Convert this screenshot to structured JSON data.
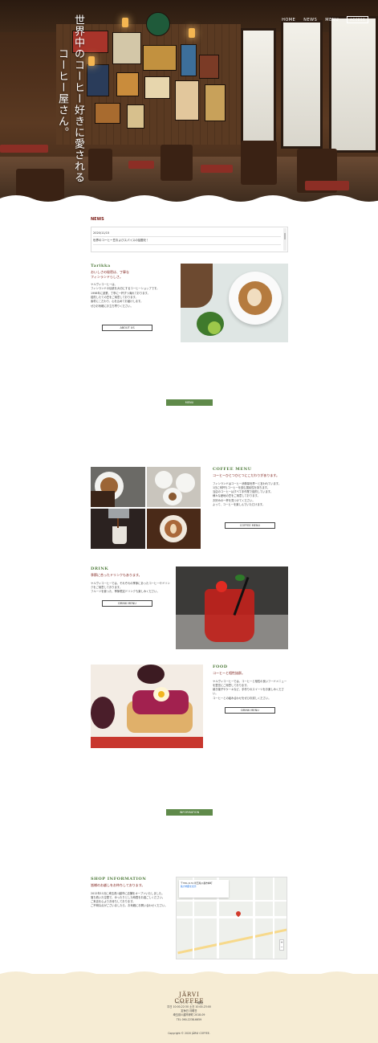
{
  "hero": {
    "title_line1": "世界中のコーヒー好きに愛される",
    "title_line2": "コーヒー屋さん。"
  },
  "nav": {
    "home": "HOME",
    "news": "NEWS",
    "menu": "MENU",
    "button": "ACCESS"
  },
  "news": {
    "title": "NEWS",
    "items": [
      {
        "text": "2020/11/15"
      },
      {
        "text": "世界のコーヒー豆およびスパイスの話題を！"
      }
    ]
  },
  "about": {
    "title_en": "Tarikka",
    "subtitle_line1": "おいしさの秘密は、丁寧な",
    "subtitle_line2": "フィンランドらしさ。",
    "body_line1": "ヤルヴィコーヒーは、",
    "body_line2": "フィンランドの伝統を大切にするコーヒーショップです。",
    "body_line3": "1998年に創業、丁寧に一杯ずつ淹れております。",
    "body_line4": "焙煎したての豆をご用意しております。",
    "body_line5": "素材にこだわり、心を込めてお届けします。",
    "body_line6": "ぜひお気軽にお立ち寄りください。",
    "button": "ABOUT US"
  },
  "menu_button": "MENU",
  "coffee": {
    "title_en": "COFFEE MENU",
    "subtitle": "コーヒーひとつひとつにこだわりがあります。",
    "body_line1": "フィンランドはコーヒー消費量世界一と言われています。",
    "body_line2": "1日に何杯もコーヒーを飲む国民性を持ちます。",
    "body_line3": "当店のコーヒーはすべて手作業で焙煎しています。",
    "body_line4": "様々な産地の豆をご用意しております。",
    "body_line5": "お好みの一杯を見つけてください。",
    "body_line6": "よって、コーヒーを楽しんでいただけます。",
    "button": "COFFEE MENU"
  },
  "drink": {
    "title_en": "DRINK",
    "subtitle": "季節に合ったドリンクもあります。",
    "body_line1": "ヤルヴィコーヒーでは、それぞれの季節にあったコーヒーやドリンクをご用意しております。",
    "body_line2": "フルーツを使った、季節限定ドリンクも楽しみください。",
    "button": "DRINK MENU"
  },
  "food": {
    "title_en": "FOOD",
    "subtitle": "コーヒーと相性抜群。",
    "body_line1": "ヤルヴィコーヒーでは、コーヒーと相性の良いフードメニューを豊富にご用意しております。",
    "body_line2": "焼き菓子やケーキなど、手作りのスイーツをお楽しみください。",
    "body_line3": "コーヒーとの組み合わせをぜひお試しください。",
    "button": "DRINK MENU"
  },
  "info_button": "INFORMATION",
  "shop": {
    "title_en": "SHOP INFORMATION",
    "subtitle": "皆様のお越しをお待ちしております。",
    "body_line1": "2012年11月に埼玉県川越市に店舗をオープンいたしました。",
    "body_line2": "落ち着いた空間で、ゆったりとした時間をお過ごしください。",
    "body_line3": "ご来店を心よりお待ちしております。",
    "body_line4": "ご不明な点がございましたら、お気軽にお問い合わせください。"
  },
  "map": {
    "info_line1": "〒350-1131 埼玉県川越市岸町",
    "info_line2": "拡大地図を表示"
  },
  "footer": {
    "logo": "JÄRVI COFFEE",
    "info_line1": "ヤルヴィコーヒー川越店",
    "info_line2": "平日 10:00-22:30 土日 10:00-23:00",
    "info_line3": "定休日 月曜日",
    "info_line4": "埼玉県川越市岸町 2018-09",
    "info_line5": "TEL 090-2238-6659",
    "copyright": "Copyright © 2020 JÄRVI COFFEE."
  },
  "colors": {
    "accent_green": "#5f8a4a",
    "accent_red": "#7a1a14",
    "footer_bg": "#f6ecd4"
  }
}
